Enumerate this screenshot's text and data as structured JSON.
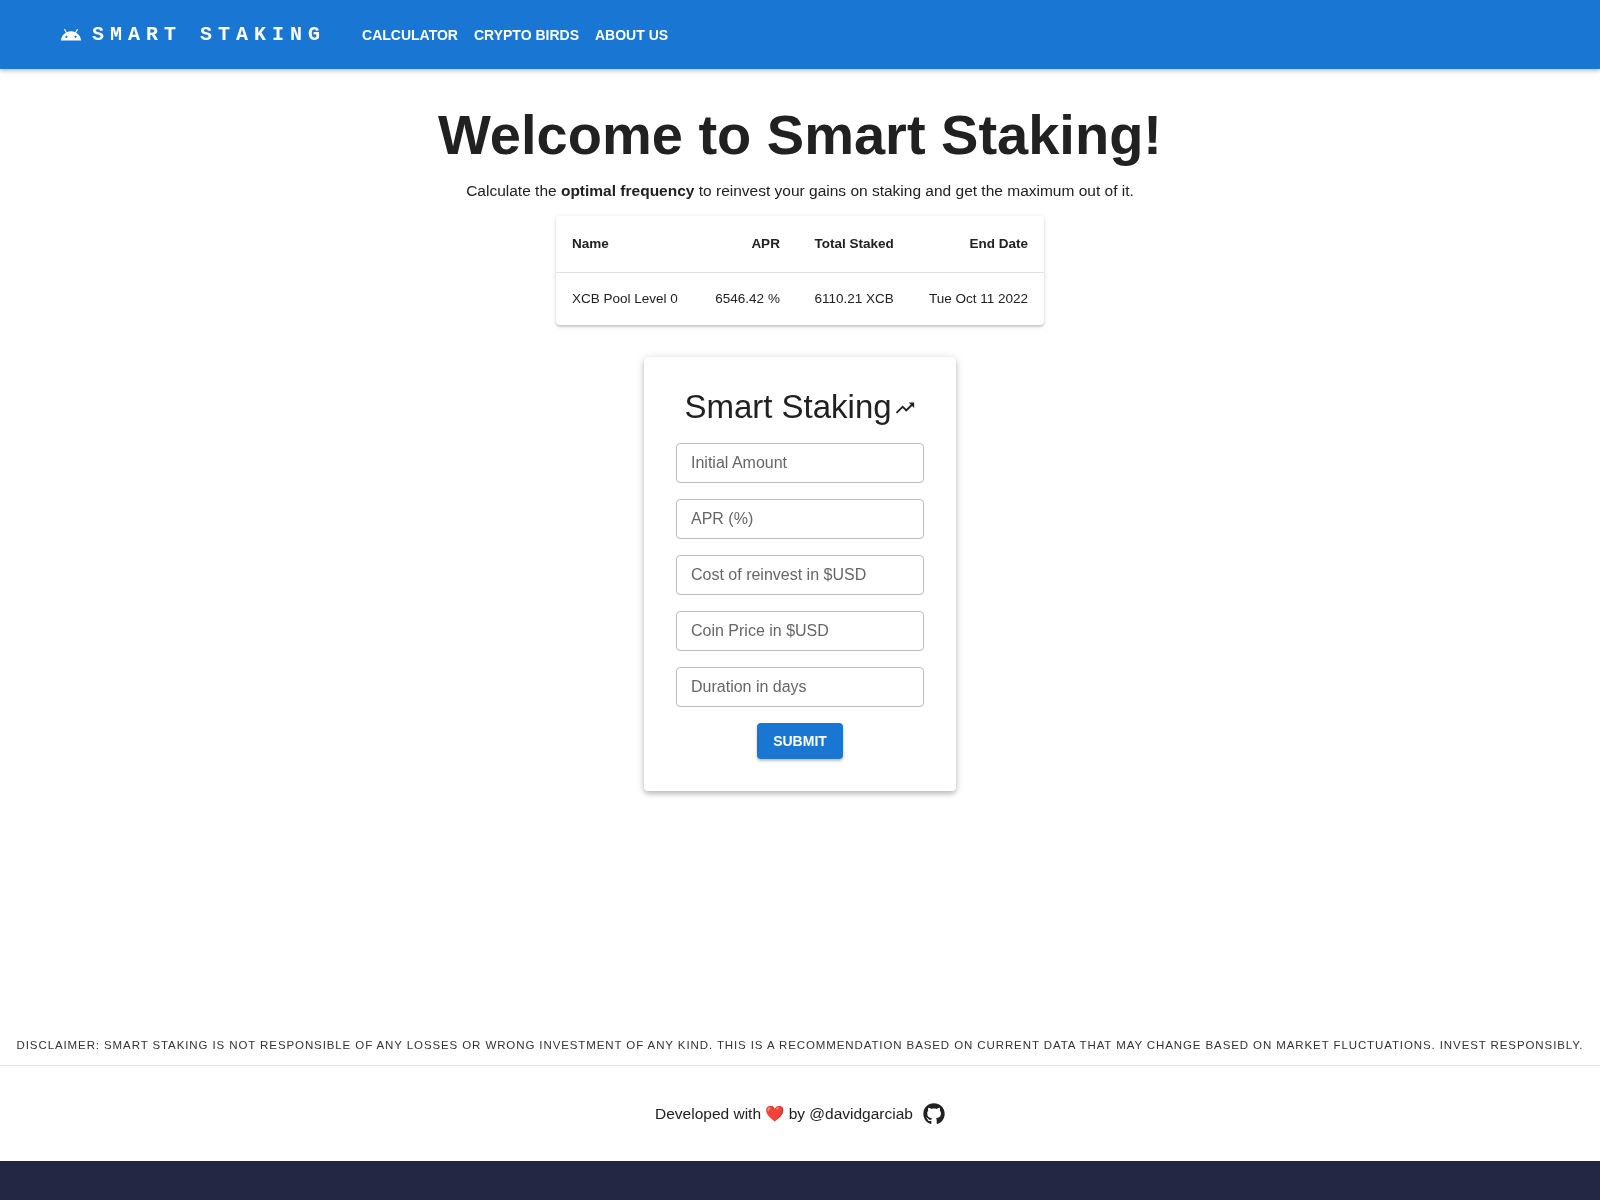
{
  "navbar": {
    "brand": "SMART STAKING",
    "links": [
      "CALCULATOR",
      "CRYPTO BIRDS",
      "ABOUT US"
    ]
  },
  "hero": {
    "title": "Welcome to Smart Staking!",
    "subtitle": "Calculate the **optimal frequency** to reinvest your gains on staking and get the maximum out of it."
  },
  "pool_table": {
    "columns": [
      "Name",
      "APR",
      "Total Staked",
      "End Date"
    ],
    "rows": [
      [
        "XCB Pool Level 0",
        "6546.42 %",
        "6110.21 XCB",
        "Tue Oct 11 2022"
      ]
    ]
  },
  "calculator": {
    "title": "Smart Staking",
    "fields": [
      {
        "placeholder": "Initial Amount"
      },
      {
        "placeholder": "APR (%)"
      },
      {
        "placeholder": "Cost of reinvest in $USD"
      },
      {
        "placeholder": "Coin Price in $USD"
      },
      {
        "placeholder": "Duration in days"
      }
    ],
    "submit": "SUBMIT"
  },
  "disclaimer": "DISCLAIMER: SMART STAKING IS NOT RESPONSIBLE OF ANY LOSSES OR WRONG INVESTMENT OF ANY KIND. THIS IS A RECOMMENDATION BASED ON CURRENT DATA THAT MAY CHANGE BASED ON MARKET FLUCTUATIONS. INVEST RESPONSIBLY.",
  "footer": {
    "credit": "Developed with ❤️ by @davidgarciab"
  }
}
